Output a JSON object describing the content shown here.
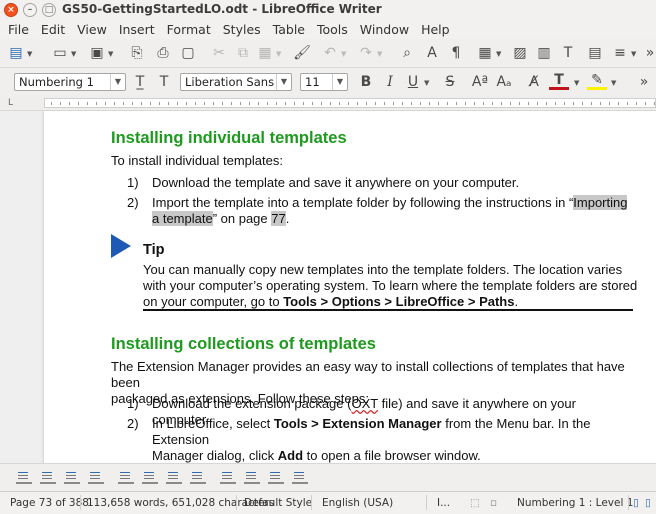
{
  "window": {
    "title": "GS50-GettingStartedLO.odt - LibreOffice Writer"
  },
  "menu": [
    "File",
    "Edit",
    "View",
    "Insert",
    "Format",
    "Styles",
    "Table",
    "Tools",
    "Window",
    "Help"
  ],
  "formatting": {
    "paragraph_style": "Numbering 1",
    "font_name": "Liberation Sans",
    "font_size": "11",
    "font_color": "#c0161b",
    "highlight_color": "#fff200"
  },
  "document": {
    "heading1": "Installing individual templates",
    "intro": "To install individual templates:",
    "steps1": [
      {
        "num": "1)",
        "text": "Download the template and save it anywhere on your computer."
      },
      {
        "num": "2)",
        "pre": "Import the template into a template folder by following the instructions in “",
        "link": "Importing a template",
        "mid": "” on page ",
        "page": "77",
        "post": "."
      }
    ],
    "tip": {
      "title": "Tip",
      "line1": "You can manually copy new templates into the template folders. The location varies",
      "line2": "with your computer’s operating system. To learn where the template folders are stored",
      "line3_pre": "on your computer, go to ",
      "line3_bold": "Tools > Options > LibreOffice > Paths",
      "line3_post": "."
    },
    "heading2": "Installing collections of templates",
    "para2_line1": "The Extension Manager provides an easy way to install collections of templates that have been",
    "para2_line2": "packaged as extensions. Follow these steps:",
    "steps2": [
      {
        "num": "1)",
        "pre": "Download the extension package (",
        "wavy": "OXT",
        "post": " file) and save it anywhere on your computer."
      },
      {
        "num": "2)",
        "pre": "In LibreOffice, select ",
        "bold": "Tools > Extension Manager",
        "post": " from the Menu bar. In the Extension",
        "line2_pre": "Manager dialog, click ",
        "line2_bold": "Add",
        "line2_post": " to open a file browser window."
      }
    ]
  },
  "status": {
    "page": "Page 73 of 388",
    "words": "113,658 words, 651,028 characters",
    "page_style": "Default Style",
    "language": "English (USA)",
    "insert_mode": "I...",
    "list_level": "Numbering 1 : Level 1"
  }
}
